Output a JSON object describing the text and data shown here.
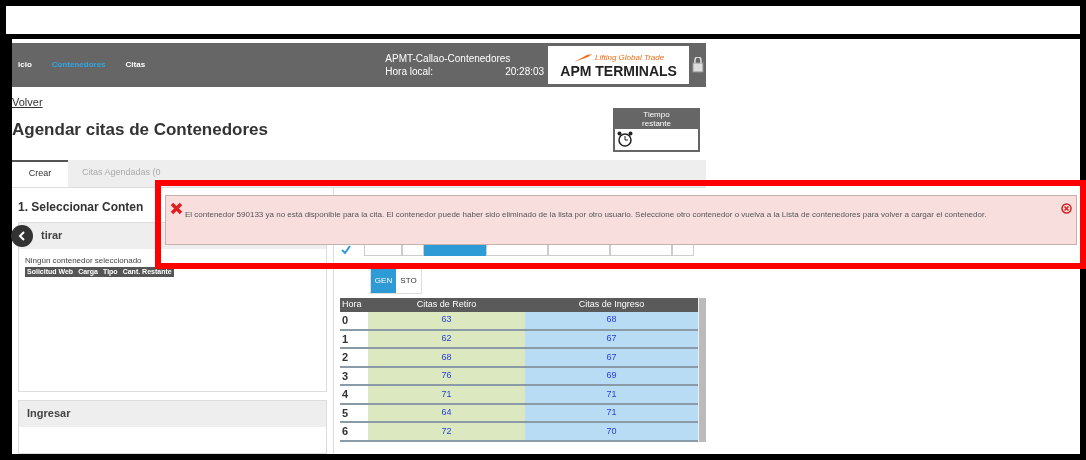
{
  "nav": {
    "items": [
      {
        "label": "icio",
        "selected": false
      },
      {
        "label": "Contenedores",
        "selected": true
      },
      {
        "label": "Citas",
        "selected": false
      }
    ],
    "terminal": "APMT-Callao-Contenedores",
    "time_label": "Hora local:",
    "time": "20:28:03",
    "logo": {
      "tagline": "Lifting Global Trade",
      "name": "APM TERMINALS"
    }
  },
  "back_link": "Volver",
  "title": "Agendar citas de Contenedores",
  "timer": {
    "label": "Tiempo restante"
  },
  "tabs": [
    {
      "label": "Crear",
      "selected": true
    },
    {
      "label": "Citas Agendadas (0",
      "selected": false
    }
  ],
  "left_panel": {
    "heading": "1. Seleccionar Conten",
    "sections": [
      {
        "title": "tirar",
        "empty_text": "Ningún contenedor seleccionado",
        "columns": [
          "Solicitud Web",
          "Carga",
          "Tipo",
          "Cant. Restante"
        ]
      },
      {
        "title": "Ingresar"
      }
    ]
  },
  "schedule": {
    "tabs": [
      {
        "label": "GEN",
        "selected": true
      },
      {
        "label": "STO",
        "selected": false
      }
    ],
    "columns": [
      "Hora",
      "Citas de Retiro",
      "Citas de Ingreso"
    ],
    "rows": [
      [
        "0",
        "63",
        "68"
      ],
      [
        "1",
        "62",
        "67"
      ],
      [
        "2",
        "68",
        "67"
      ],
      [
        "3",
        "76",
        "69"
      ],
      [
        "4",
        "71",
        "71"
      ],
      [
        "5",
        "64",
        "71"
      ],
      [
        "6",
        "72",
        "70"
      ]
    ]
  },
  "alert": {
    "kind": "error",
    "message": "El contenedor 590133 ya no está disponible para la cita. El contenedor puede haber sido eliminado de la lista por otro usuario. Seleccione otro contenedor o vuelva a la Lista de contenedores para volver a cargar el contenedor."
  }
}
